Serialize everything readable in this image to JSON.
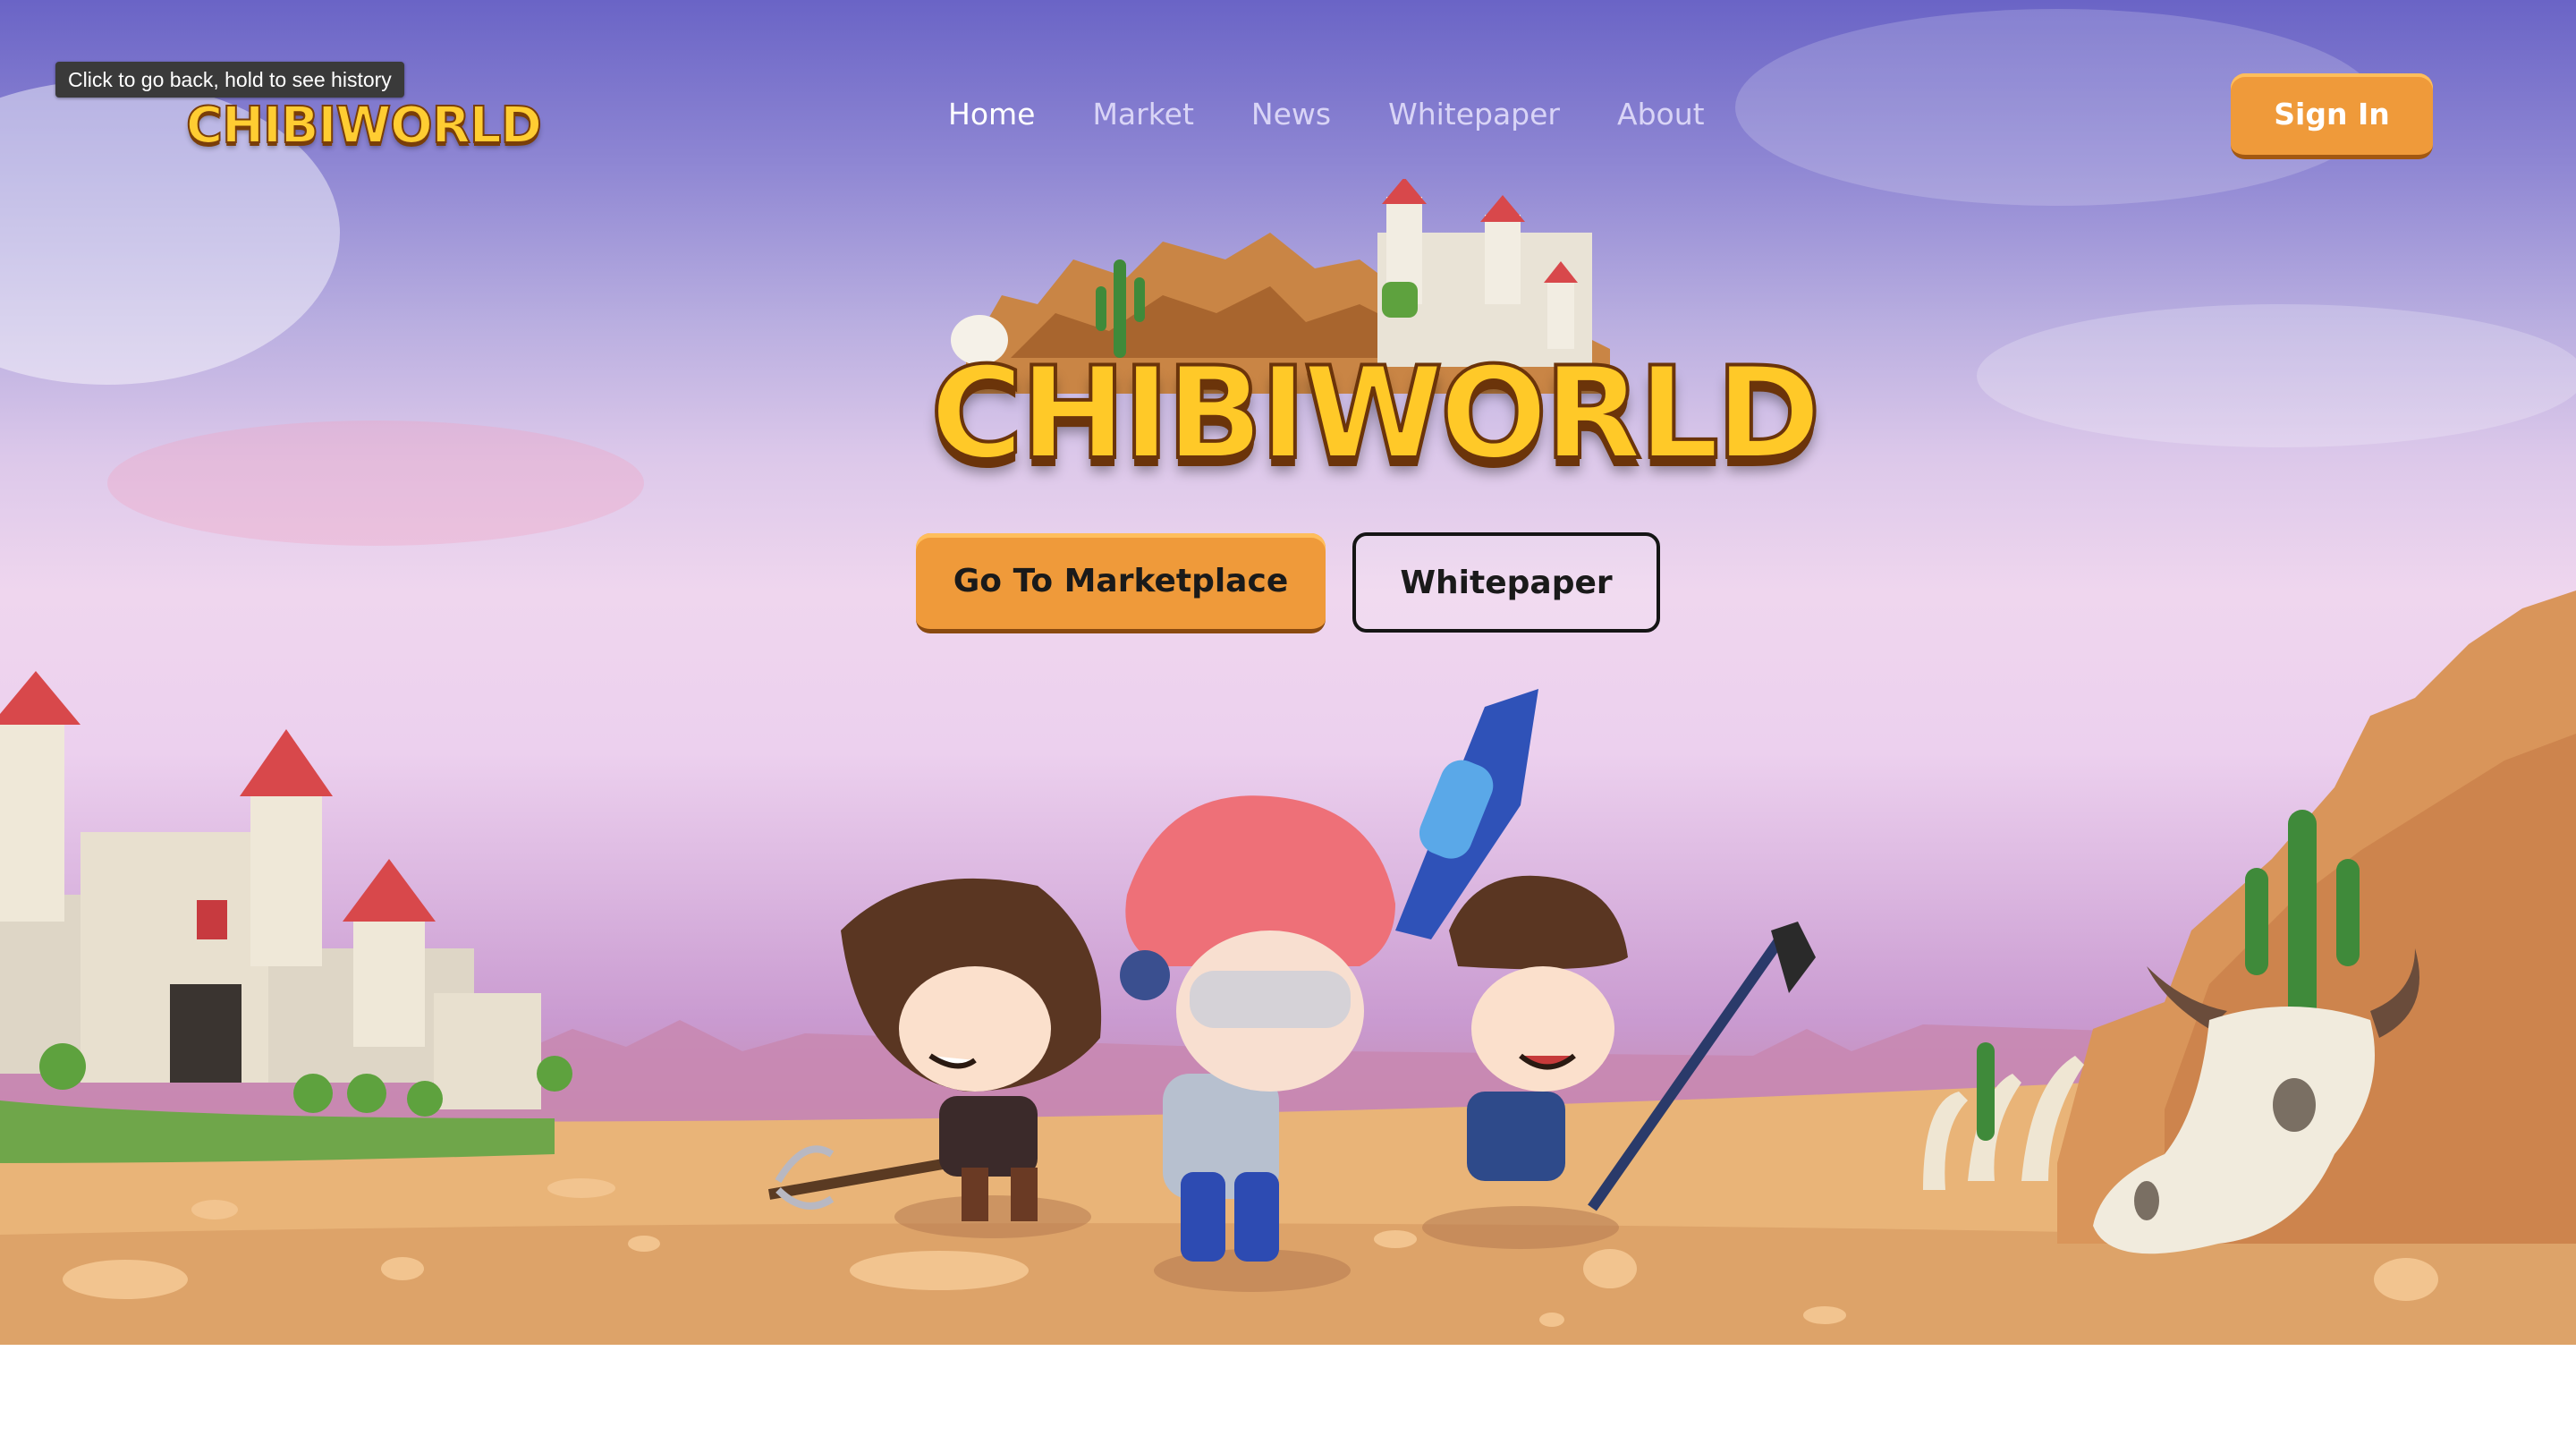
{
  "browser": {
    "tooltip": "Click to go back, hold to see history"
  },
  "header": {
    "logo_text": "CHIBIWORLD",
    "nav": [
      {
        "label": "Home",
        "active": true
      },
      {
        "label": "Market",
        "active": false
      },
      {
        "label": "News",
        "active": false
      },
      {
        "label": "Whitepaper",
        "active": false
      },
      {
        "label": "About",
        "active": false
      }
    ],
    "sign_in_label": "Sign In"
  },
  "hero": {
    "logo_text": "CHIBIWORLD",
    "primary_button_label": "Go To Marketplace",
    "secondary_button_label": "Whitepaper"
  },
  "colors": {
    "accent_orange": "#ef9a3a",
    "logo_gold": "#ffc928",
    "sky_top": "#6a64c6",
    "sand": "#e3b07a"
  }
}
